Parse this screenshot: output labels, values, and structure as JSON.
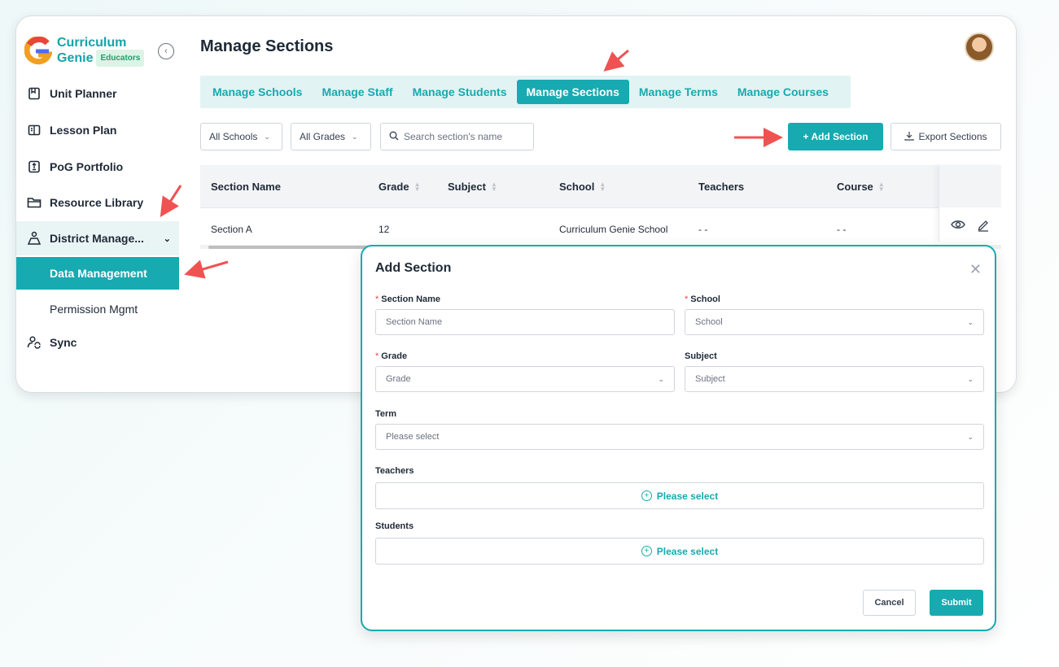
{
  "brand": {
    "name_line1": "Curriculum",
    "name_line2": "Genie",
    "badge": "Educators"
  },
  "sidebar": {
    "items": [
      {
        "label": "Unit Planner",
        "icon": "bookmark-icon"
      },
      {
        "label": "Lesson Plan",
        "icon": "book-open-icon"
      },
      {
        "label": "PoG Portfolio",
        "icon": "portfolio-icon"
      },
      {
        "label": "Resource Library",
        "icon": "folder-icon"
      },
      {
        "label": "District Manage...",
        "icon": "org-icon"
      },
      {
        "label": "Data Management",
        "icon": ""
      },
      {
        "label": "Permission Mgmt",
        "icon": ""
      },
      {
        "label": "Sync",
        "icon": "sync-users-icon"
      }
    ]
  },
  "header": {
    "title": "Manage Sections"
  },
  "tabs": [
    {
      "label": "Manage Schools"
    },
    {
      "label": "Manage Staff"
    },
    {
      "label": "Manage Students"
    },
    {
      "label": "Manage Sections"
    },
    {
      "label": "Manage Terms"
    },
    {
      "label": "Manage Courses"
    }
  ],
  "filters": {
    "school": "All Schools",
    "grade": "All Grades",
    "search_placeholder": "Search section's name"
  },
  "actions": {
    "add": "+ Add Section",
    "export": "Export Sections"
  },
  "table": {
    "columns": [
      "Section Name",
      "Grade",
      "Subject",
      "School",
      "Teachers",
      "Course"
    ],
    "rows": [
      {
        "section": "Section A",
        "grade": "12",
        "subject": "",
        "school": "Curriculum Genie School",
        "teachers": "- -",
        "course": "- -"
      }
    ]
  },
  "modal": {
    "title": "Add Section",
    "fields": {
      "section_name_label": "Section Name",
      "section_name_placeholder": "Section Name",
      "school_label": "School",
      "school_placeholder": "School",
      "grade_label": "Grade",
      "grade_placeholder": "Grade",
      "subject_label": "Subject",
      "subject_placeholder": "Subject",
      "term_label": "Term",
      "term_placeholder": "Please select",
      "teachers_label": "Teachers",
      "teachers_picker": "Please select",
      "students_label": "Students",
      "students_picker": "Please select"
    },
    "cancel": "Cancel",
    "submit": "Submit"
  },
  "colors": {
    "accent": "#17aab0",
    "annotation_arrow": "#f05252"
  }
}
